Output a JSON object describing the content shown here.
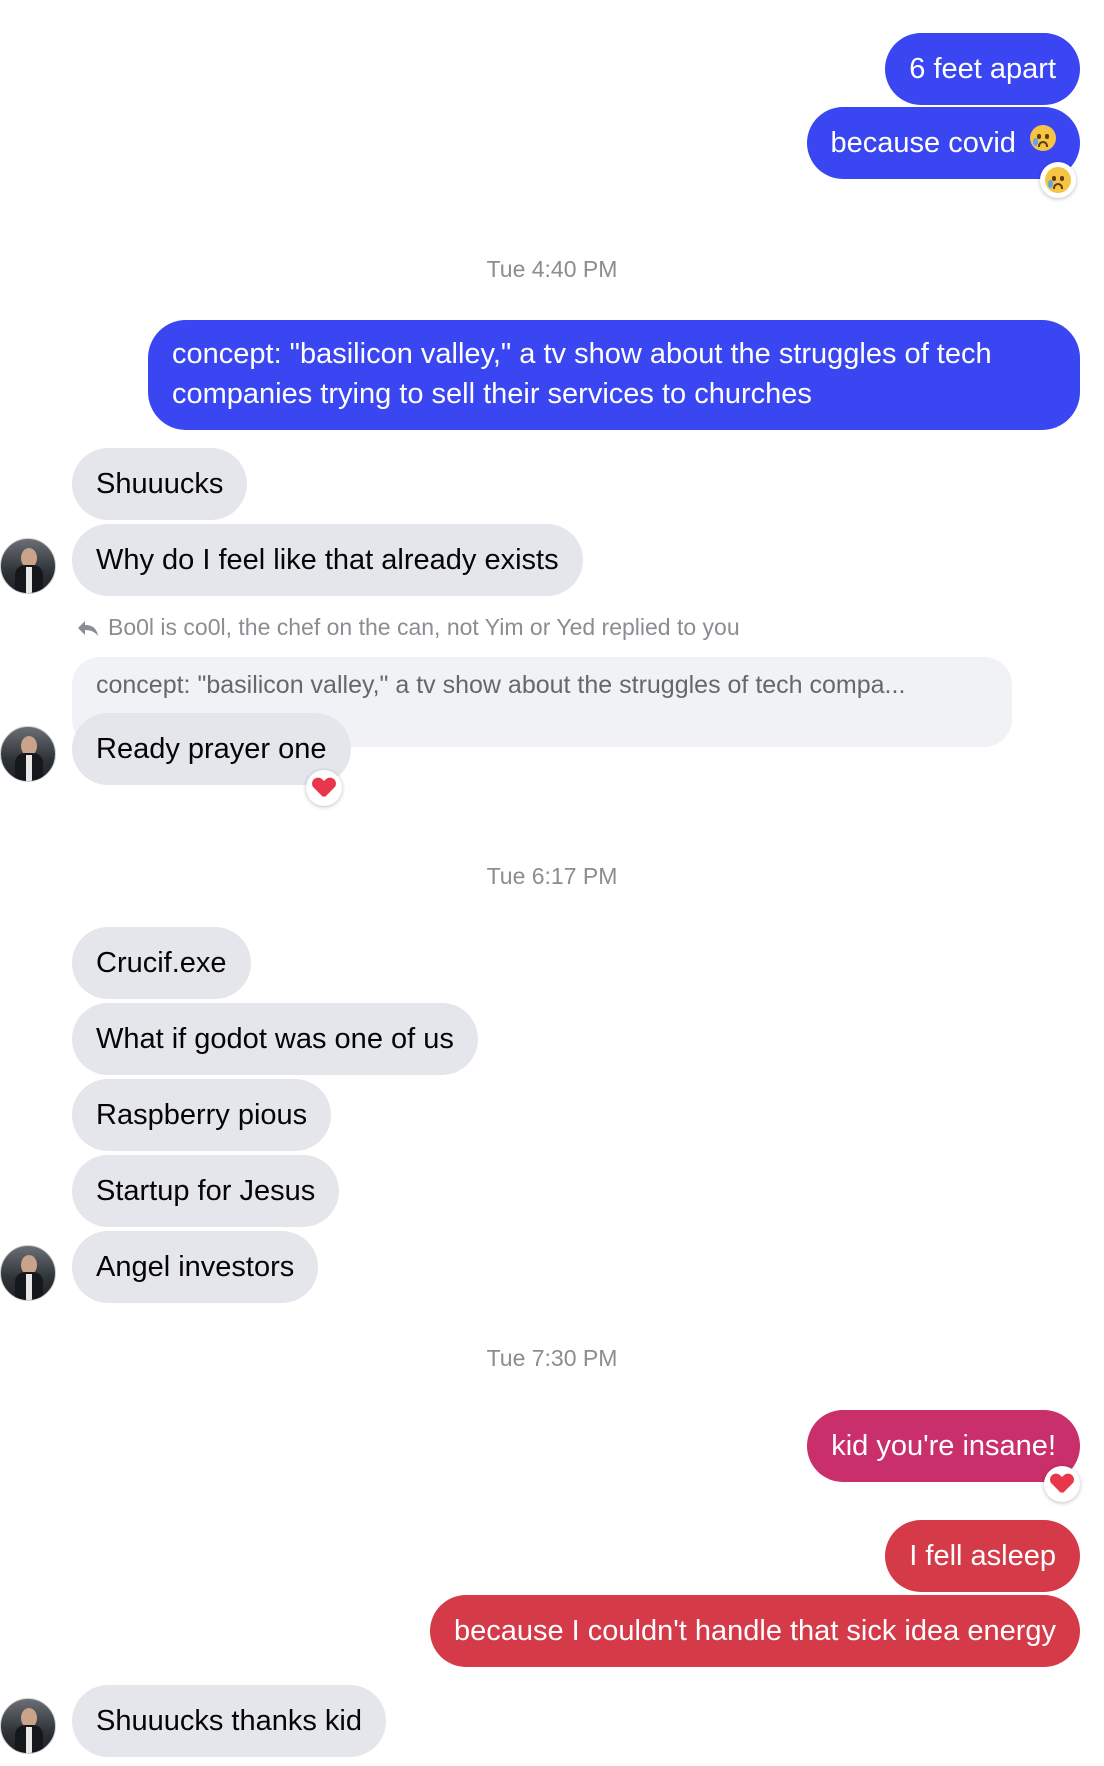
{
  "timestamps": [
    "Tue 4:40 PM",
    "Tue 6:17 PM",
    "Tue 7:30 PM"
  ],
  "messages": {
    "m1": "6 feet apart",
    "m2": "because covid",
    "m3": "concept: \"basilicon valley,\" a tv show about the struggles of tech companies trying to sell their services to churches",
    "m4": "Shuuucks",
    "m5": "Why do I feel like that already exists",
    "m6": "Ready prayer one",
    "m7": "Crucif.exe",
    "m8": "What if godot was one of us",
    "m9": "Raspberry pious",
    "m10": "Startup for Jesus",
    "m11": "Angel investors",
    "m12": "kid you're insane!",
    "m13": "I fell asleep",
    "m14": "because I couldn't handle that sick idea energy",
    "m15": "Shuuucks thanks kid"
  },
  "reply": {
    "label": "Bo0l is co0l, the chef on the can, not Yim or Yed replied to you",
    "quoted": "concept: \"basilicon valley,\" a tv show about the struggles of tech compa..."
  },
  "reactions": {
    "m2": "crying-face-emoji",
    "m6": "heart-emoji",
    "m12": "heart-emoji"
  },
  "colors": {
    "outgoing_blue": "#3a46f2",
    "outgoing_pink": "#c92f6a",
    "outgoing_red": "#d43a48",
    "incoming_gray": "#e4e6eb",
    "timestamp_gray": "#8a8d91"
  }
}
